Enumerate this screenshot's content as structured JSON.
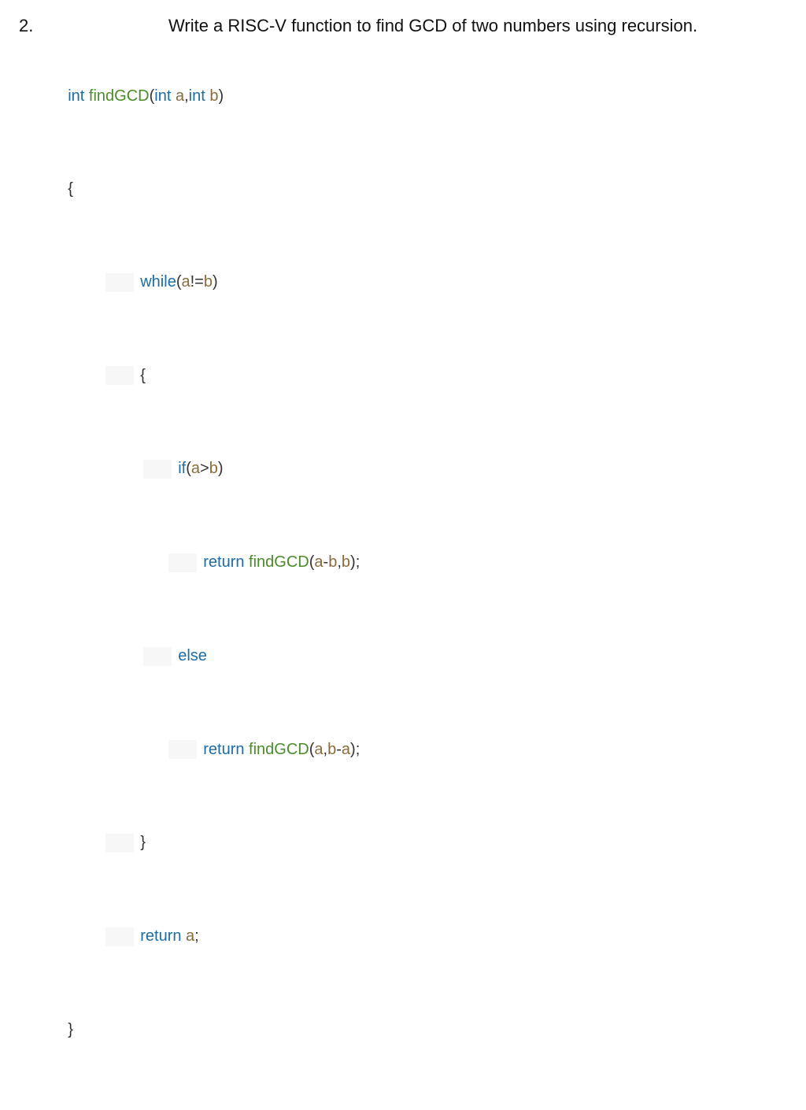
{
  "header": {
    "number": "2.",
    "title": "Write a RISC-V function to find GCD of two numbers using recursion."
  },
  "code": {
    "sig": {
      "int1": "int",
      "fn": "findGCD",
      "lp": "(",
      "int2": "int",
      "sp1": " ",
      "a": "a",
      "comma": ",",
      "int3": "int",
      "sp2": " ",
      "b": "b",
      "rp": ")"
    },
    "brace_open": "{",
    "whileLine": {
      "kw": "while",
      "lp": "(",
      "a": "a",
      "neq": "!=",
      "b": "b",
      "rp": ")"
    },
    "inner_brace_open": "{",
    "ifLine": {
      "kw": "if",
      "lp": "(",
      "a": "a",
      "gt": ">",
      "b": "b",
      "rp": ")"
    },
    "ret1": {
      "kw": "return",
      "sp": " ",
      "fn": "findGCD",
      "lp": "(",
      "a": "a",
      "minus": "-",
      "b1": "b",
      "comma": ",",
      "b2": "b",
      "rp": ");"
    },
    "elseLine": "else",
    "ret2": {
      "kw": "return",
      "sp": " ",
      "fn": "findGCD",
      "lp": "(",
      "a1": "a",
      "comma": ",",
      "b": "b",
      "minus": "-",
      "a2": "a",
      "rp": ");"
    },
    "inner_brace_close": "}",
    "retA": {
      "kw": "return",
      "sp": " ",
      "a": "a",
      "semi": ";"
    },
    "brace_close": "}"
  }
}
